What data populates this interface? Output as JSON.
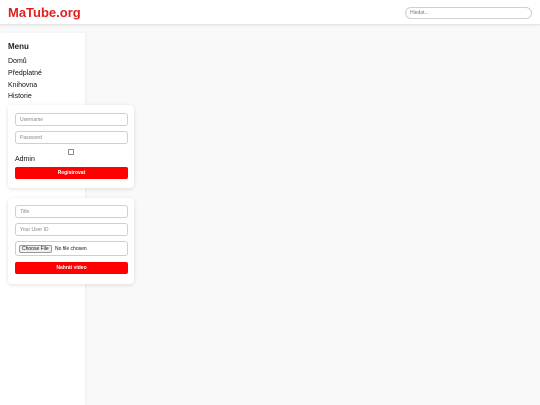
{
  "header": {
    "logo": "MaTube.org",
    "search_placeholder": "Hledat..."
  },
  "sidebar": {
    "title": "Menu",
    "items": [
      {
        "label": "Domů"
      },
      {
        "label": "Předplatné"
      },
      {
        "label": "Knihovna"
      },
      {
        "label": "Historie"
      }
    ]
  },
  "login_form": {
    "username_placeholder": "Username",
    "password_placeholder": "Password",
    "admin_checked": false,
    "admin_label": "Admin",
    "submit_label": "Registrovat"
  },
  "upload_form": {
    "title_placeholder": "Title",
    "user_id_placeholder": "Your User ID",
    "choose_file_label": "Choose File",
    "file_status": "No file chosen",
    "submit_label": "Nahrát video"
  },
  "colors": {
    "brand": "#e02020",
    "button": "#ff0000",
    "background": "#f9f9f9"
  }
}
